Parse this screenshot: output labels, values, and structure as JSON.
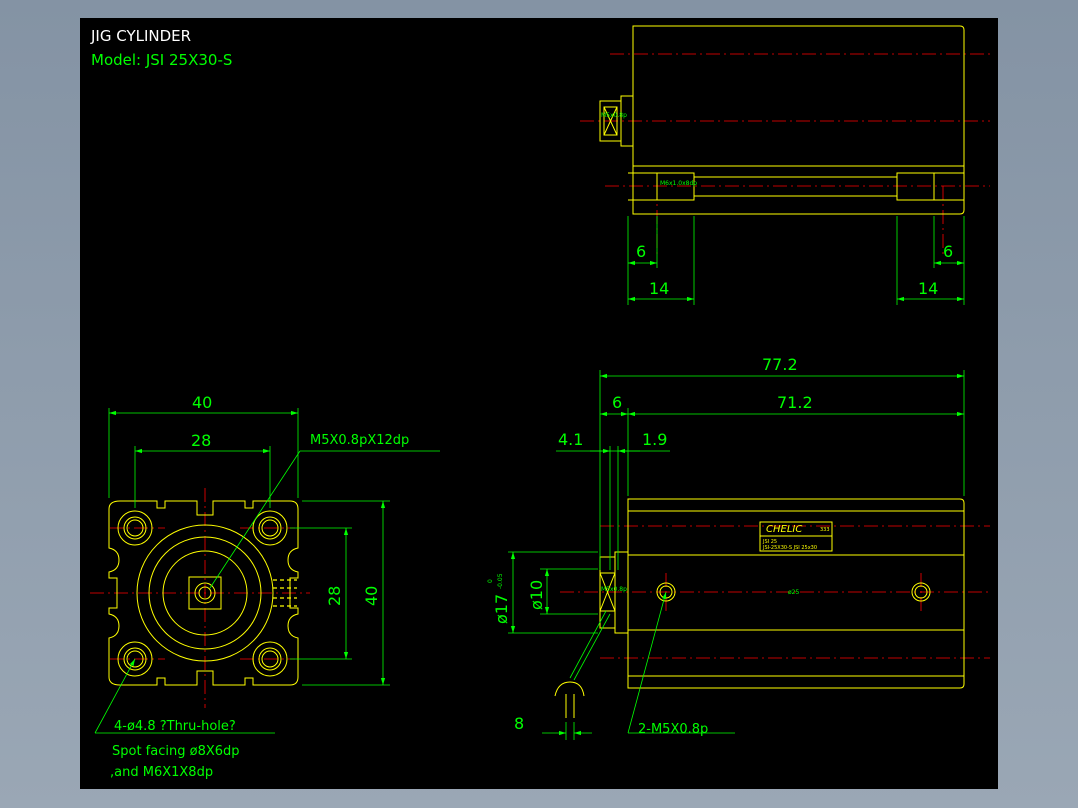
{
  "drawing": {
    "title": "JIG CYLINDER",
    "model": "Model:  JSI  25X30-S"
  },
  "colors": {
    "background": "#000000",
    "outline": "#ffff00",
    "dimension": "#00ff00",
    "centerline": "#ff0000",
    "frame": "#8c9bab"
  },
  "top_view": {
    "port_label": "M5x0.8p",
    "bolt_label": "M6x1.0x8dp",
    "dim_left_6": "6",
    "dim_right_6": "6",
    "dim_left_14": "14",
    "dim_right_14": "14"
  },
  "front_view": {
    "dim_40_top": "40",
    "dim_28_top": "28",
    "dim_28_side": "28",
    "dim_40_side": "40",
    "thread_callout": "M5X0.8pX12dp",
    "hole_note_line1": "4-ø4.8 ?Thru-hole?",
    "hole_note_line2": "Spot facing  ø8X6dp",
    "hole_note_line3": ",and M6X1X8dp"
  },
  "side_view": {
    "dim_77_2": "77.2",
    "dim_6": "6",
    "dim_71_2": "71.2",
    "dim_4_1": "4.1",
    "dim_1_9": "1.9",
    "dim_phi17": "ø17",
    "dim_phi17_tol_upper": "0",
    "dim_phi17_tol_lower": "-0.05",
    "dim_phi10": "ø10",
    "dim_8": "8",
    "port_callout": "2-M5X0.8p",
    "port_label": "M5x0.8p",
    "bore_label": "ø25",
    "logo": "CHELIC",
    "logo_suffix": "333",
    "nameplate_line1": "JSI 25",
    "nameplate_line2": "JSI-25X30-S  JSI 25x30"
  }
}
